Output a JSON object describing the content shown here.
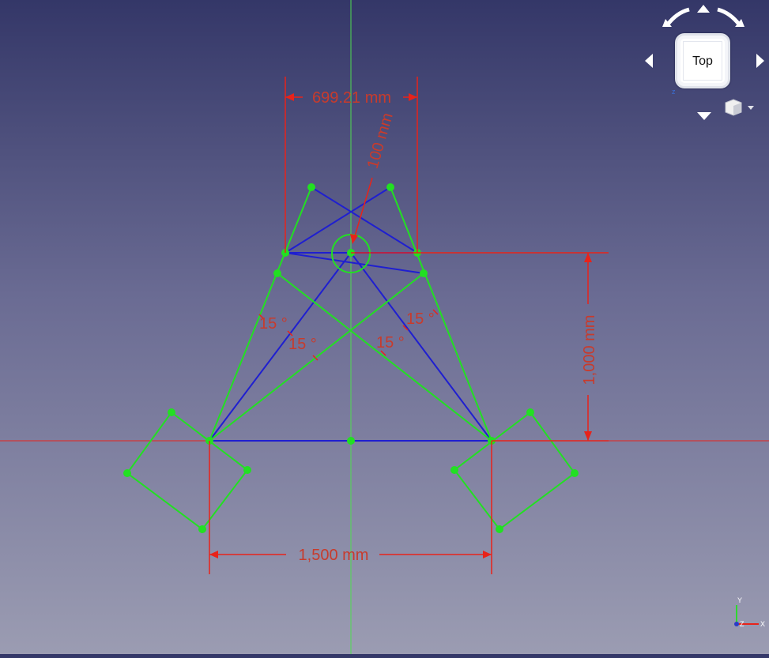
{
  "view": {
    "navcube_face_label": "Top",
    "navcube_axis_label": "z"
  },
  "dimensions": {
    "top_width": "699.21 mm",
    "circle_diameter": "100 mm",
    "height": "1,000 mm",
    "base_width": "1,500 mm",
    "angle_left_outer": "15 °",
    "angle_left_inner": "15 °",
    "angle_right_inner": "15 °",
    "angle_right_outer": "15 °"
  },
  "triad": {
    "y": "Y",
    "z": "Z",
    "x": "X"
  },
  "colors": {
    "construction": "#1f1fd0",
    "geometry": "#22e022",
    "dimension": "#e8231a",
    "dimension_text": "#c83b2c"
  },
  "icons": [
    "orbit-arrow-icon",
    "rotate-arrow-icon",
    "cube-menu-icon"
  ]
}
